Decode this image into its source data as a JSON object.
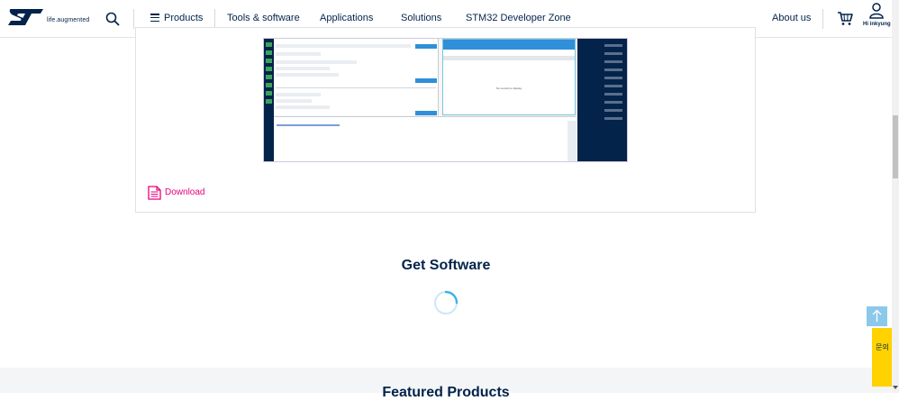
{
  "header": {
    "logo_alt": "ST",
    "tagline": "life.augmented",
    "nav": {
      "products": "Products",
      "tools": "Tools & software",
      "applications": "Applications",
      "solutions": "Solutions",
      "stm32": "STM32 Developer Zone",
      "about": "About us"
    },
    "user_label": "Hi inkyung"
  },
  "card": {
    "screenshot_message": "No records to display",
    "download_label": "Download"
  },
  "section": {
    "title": "Get Software",
    "featured_title": "Featured Products"
  },
  "feedback": {
    "label": "문의"
  },
  "colors": {
    "brand": "#03234b",
    "accent": "#e6007e",
    "feedback": "#ffd200",
    "back_to_top": "#8cc8ea"
  }
}
